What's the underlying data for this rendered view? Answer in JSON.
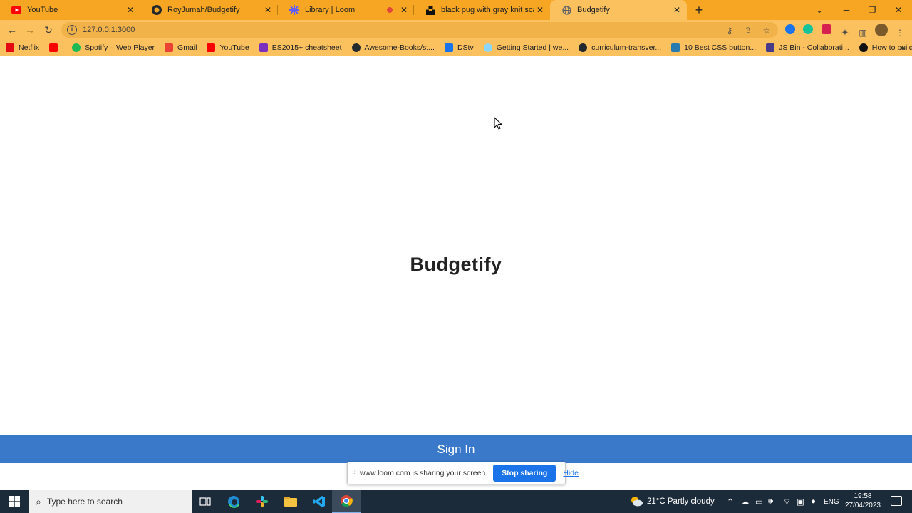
{
  "browser": {
    "tabs": [
      {
        "title": "YouTube",
        "icon": "youtube-icon",
        "color": "#ff0000"
      },
      {
        "title": "RoyJumah/Budgetify",
        "icon": "github-icon",
        "color": "#24292e"
      },
      {
        "title": "Library | Loom",
        "icon": "loom-icon",
        "color": "#625df5"
      },
      {
        "title": "black pug with gray knit scarf ph",
        "icon": "unsplash-icon",
        "color": "#111111"
      },
      {
        "title": "Budgetify",
        "icon": "globe-icon",
        "color": "#5f6368"
      }
    ],
    "url": "127.0.0.1:3000",
    "bookmarks": [
      {
        "label": "Netflix",
        "color": "#e50914"
      },
      {
        "label": "",
        "color": "#ff0000"
      },
      {
        "label": "Spotify – Web Player",
        "color": "#1db954"
      },
      {
        "label": "Gmail",
        "color": "#ea4335"
      },
      {
        "label": "YouTube",
        "color": "#ff0000"
      },
      {
        "label": "ES2015+ cheatsheet",
        "color": "#7b2fbf"
      },
      {
        "label": "Awesome-Books/st...",
        "color": "#24292e"
      },
      {
        "label": "DStv",
        "color": "#1a73e8"
      },
      {
        "label": "Getting Started | we...",
        "color": "#8ed6fb"
      },
      {
        "label": "curriculum-transver...",
        "color": "#24292e"
      },
      {
        "label": "10 Best CSS button...",
        "color": "#2a7ab0"
      },
      {
        "label": "JS Bin - Collaborati...",
        "color": "#4a3a8a"
      },
      {
        "label": "How to build React...",
        "color": "#111111"
      }
    ]
  },
  "page": {
    "brand": "Budgetify",
    "signin": "Sign In"
  },
  "loom_banner": {
    "message": "www.loom.com is sharing your screen.",
    "stop": "Stop sharing",
    "hide": "Hide"
  },
  "taskbar": {
    "search_placeholder": "Type here to search",
    "weather": "21°C  Partly cloudy",
    "language": "ENG",
    "time": "19:58",
    "date": "27/04/2023"
  }
}
